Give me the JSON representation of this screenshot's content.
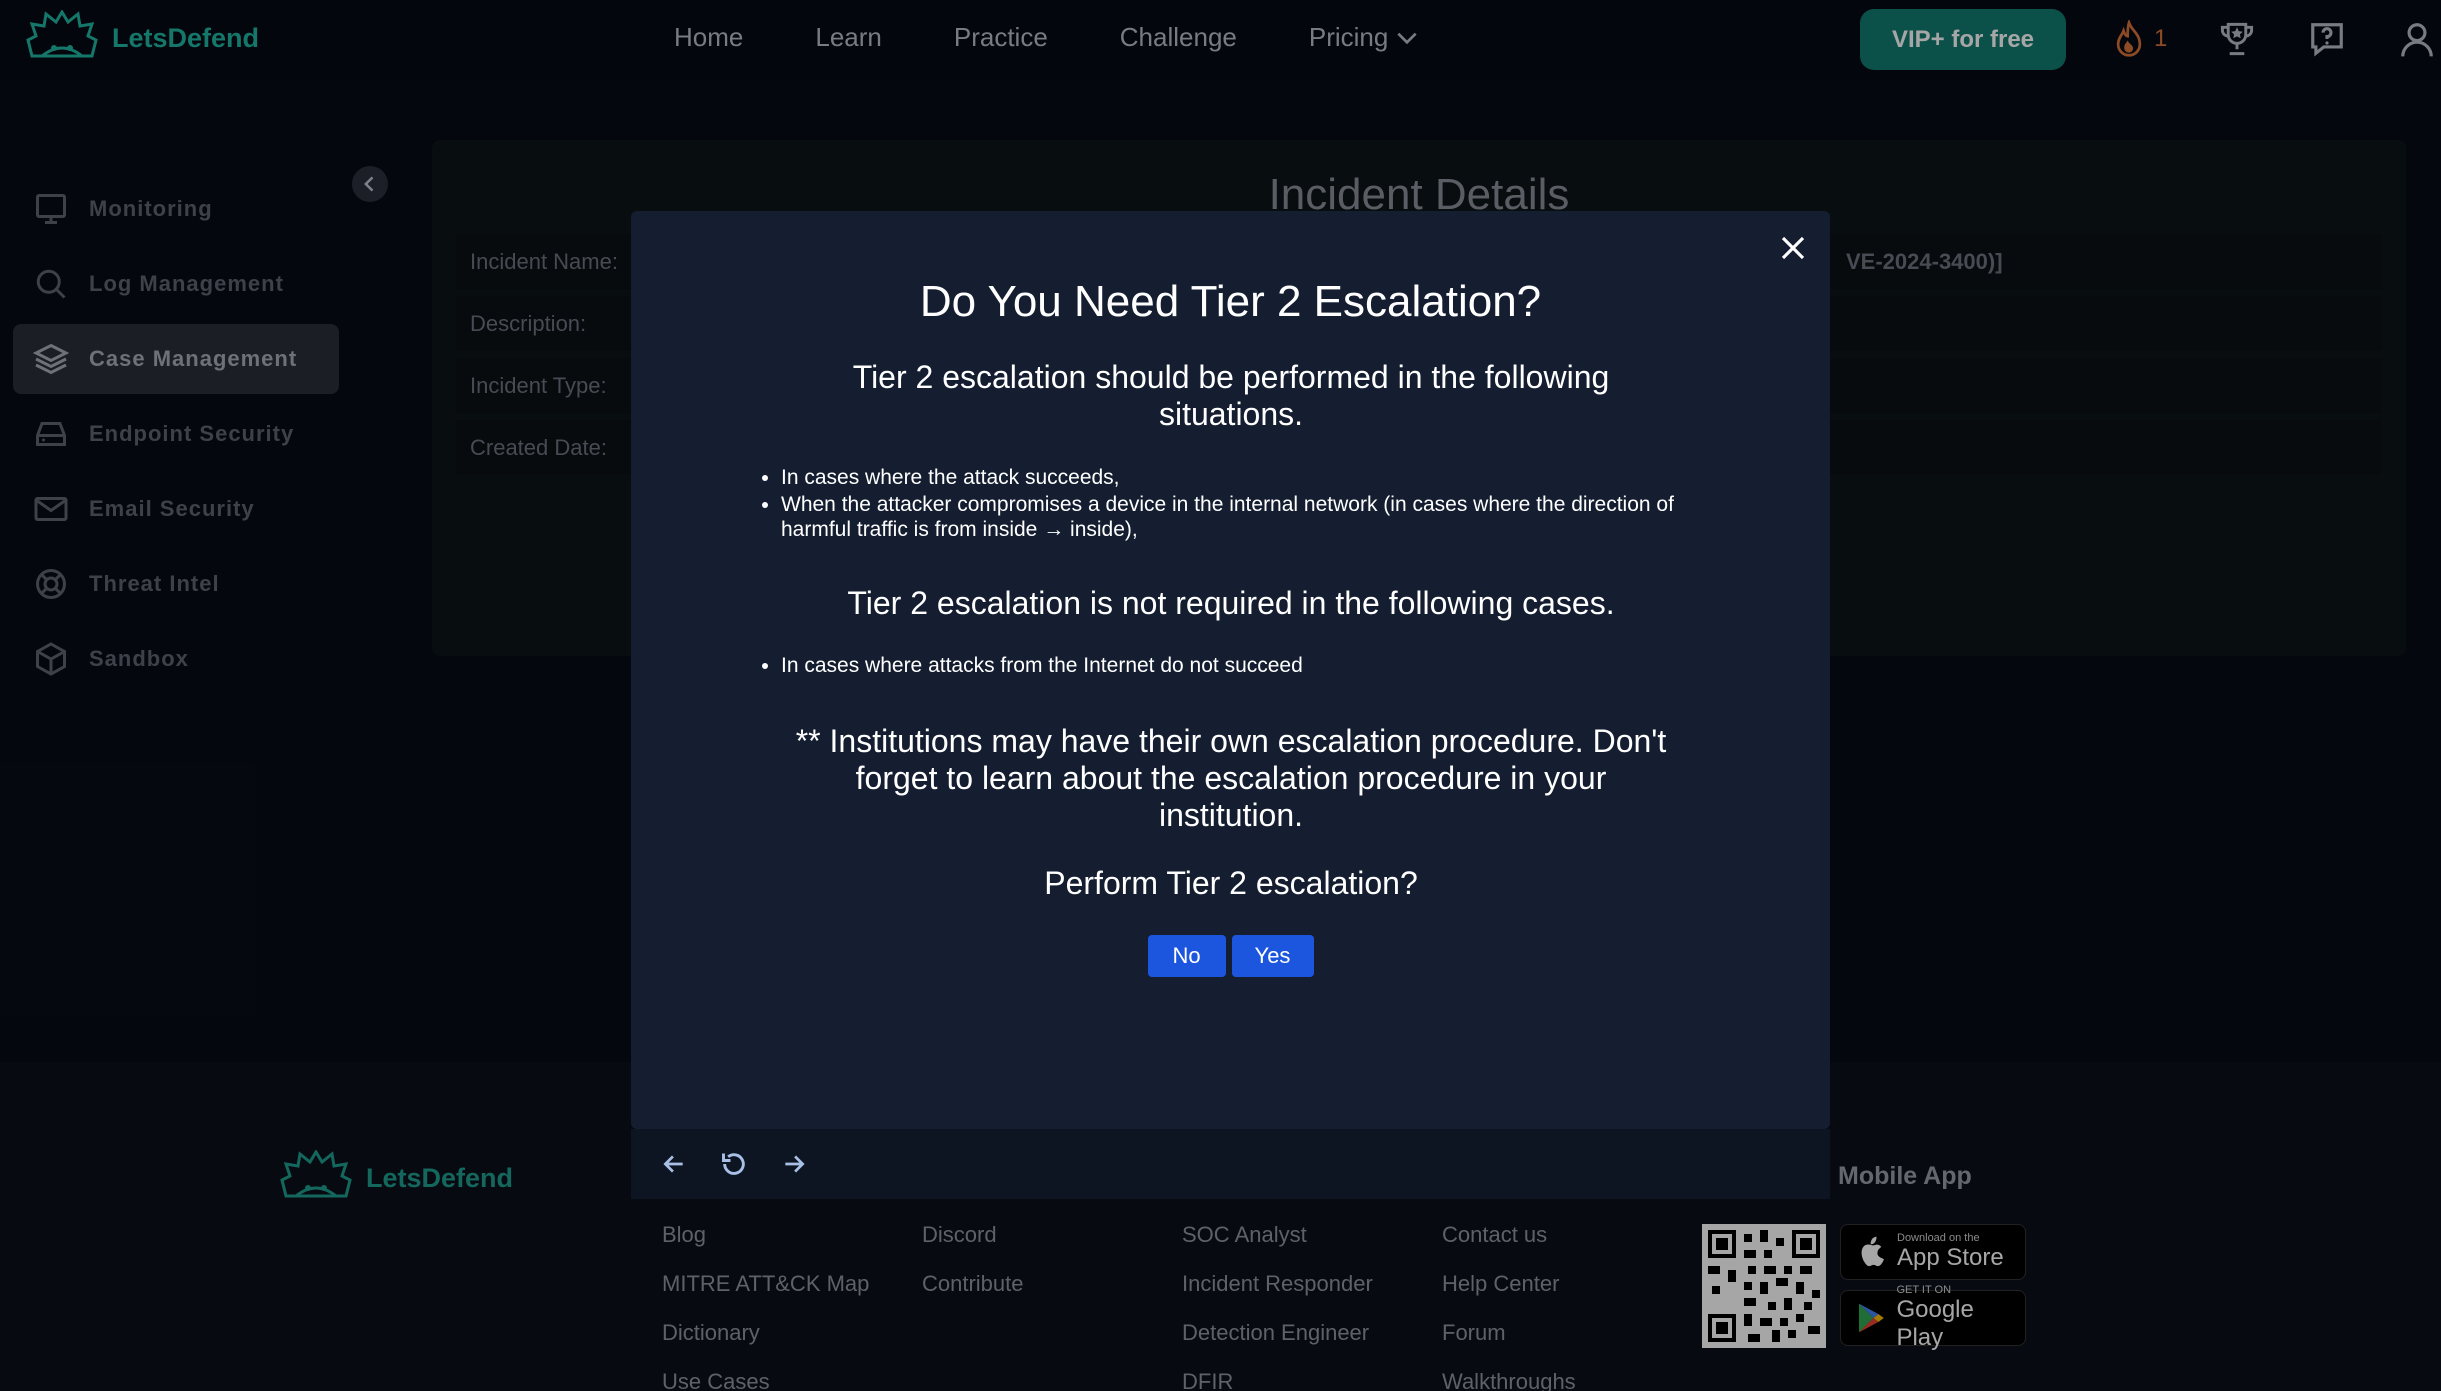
{
  "topnav": {
    "brand": "LetsDefend",
    "links": [
      "Home",
      "Learn",
      "Practice",
      "Challenge",
      "Pricing"
    ],
    "vip_button": "VIP+ for free",
    "streak_count": "1",
    "icons": [
      "fire-icon",
      "trophy-icon",
      "help-icon",
      "user-icon"
    ]
  },
  "sidebar": {
    "items": [
      {
        "label": "Monitoring",
        "icon": "monitor-icon"
      },
      {
        "label": "Log Management",
        "icon": "search-icon"
      },
      {
        "label": "Case Management",
        "icon": "layers-icon",
        "active": true
      },
      {
        "label": "Endpoint Security",
        "icon": "drive-icon"
      },
      {
        "label": "Email Security",
        "icon": "mail-icon"
      },
      {
        "label": "Threat Intel",
        "icon": "lifebuoy-icon"
      },
      {
        "label": "Sandbox",
        "icon": "cube-icon"
      }
    ]
  },
  "incident": {
    "title": "Incident Details",
    "rows": [
      {
        "label": "Incident Name:",
        "value": "VE-2024-3400)]"
      },
      {
        "label": "Description:",
        "value": ""
      },
      {
        "label": "Incident Type:",
        "value": ""
      },
      {
        "label": "Created Date:",
        "value": ""
      }
    ]
  },
  "modal": {
    "title": "Do You Need Tier 2 Escalation?",
    "required_heading": "Tier 2 escalation should be performed in the following situations.",
    "required_items": [
      "In cases where the attack succeeds,",
      "When the attacker compromises a device in the internal network (in cases where the direction of harmful traffic is from inside → inside),"
    ],
    "not_required_heading": "Tier 2 escalation is not required in the following cases.",
    "not_required_items": [
      "In cases where attacks from the Internet do not succeed"
    ],
    "note": "** Institutions may have their own escalation procedure. Don't forget to learn about the escalation procedure in your institution.",
    "question": "Perform Tier 2 escalation?",
    "no_label": "No",
    "yes_label": "Yes"
  },
  "footer": {
    "brand": "LetsDefend",
    "col1": [
      "Blog",
      "MITRE ATT&CK Map",
      "Dictionary",
      "Use Cases"
    ],
    "col2": [
      "Discord",
      "Contribute"
    ],
    "col3": [
      "SOC Analyst",
      "Incident Responder",
      "Detection Engineer",
      "DFIR"
    ],
    "col4": [
      "Contact us",
      "Help Center",
      "Forum",
      "Walkthroughs"
    ],
    "mobile_title": "Mobile App",
    "app_store": {
      "small": "Download on the",
      "big": "App Store"
    },
    "google_play": {
      "small": "GET IT ON",
      "big": "Google Play"
    }
  },
  "colors": {
    "accent": "#21b5a3",
    "button_blue": "#1d56de",
    "modal_bg": "#141e30",
    "streak": "#d7723a"
  }
}
